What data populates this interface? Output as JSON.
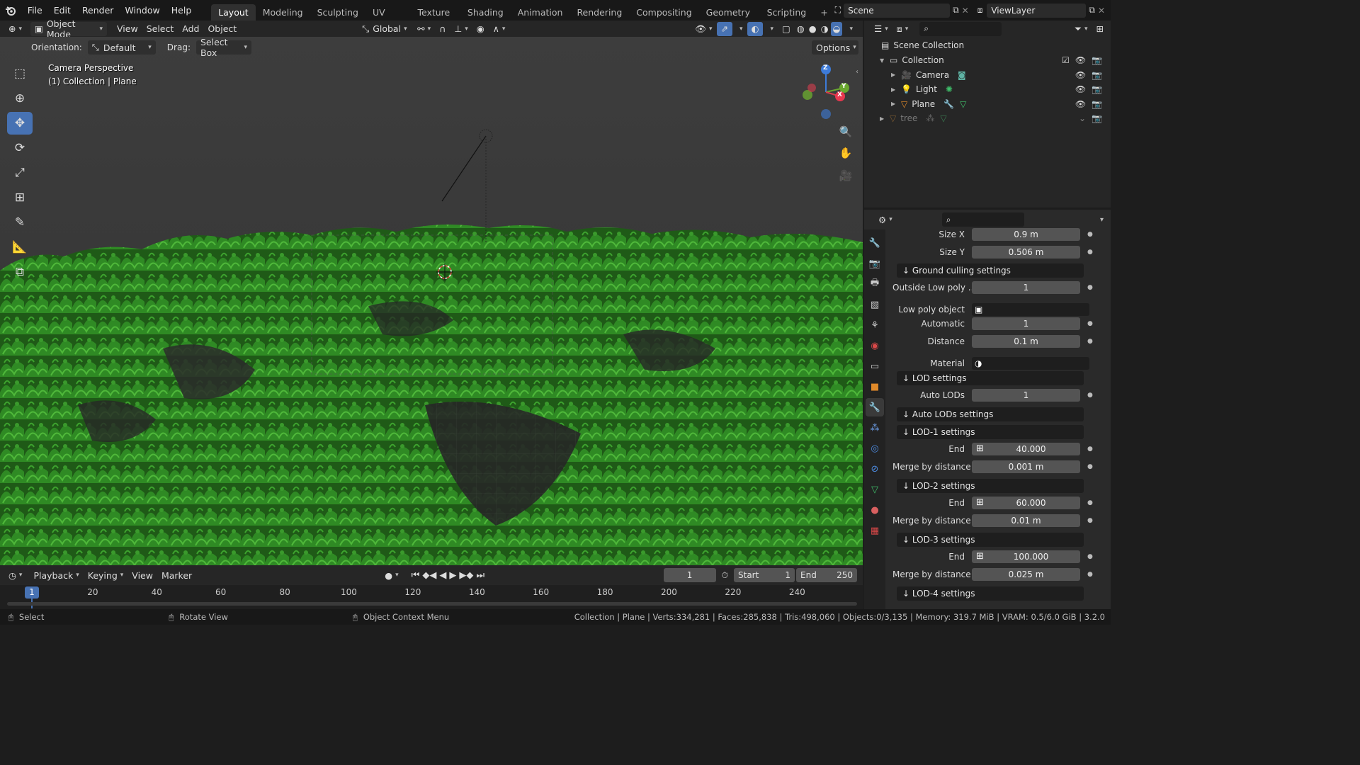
{
  "topbar": {
    "menus": [
      "File",
      "Edit",
      "Render",
      "Window",
      "Help"
    ],
    "workspaces": [
      "Layout",
      "Modeling",
      "Sculpting",
      "UV Editing",
      "Texture Paint",
      "Shading",
      "Animation",
      "Rendering",
      "Compositing",
      "Geometry Nodes",
      "Scripting"
    ],
    "active_workspace": "Layout",
    "add_workspace": "+",
    "scene_name": "Scene",
    "view_layer": "ViewLayer"
  },
  "viewport_header": {
    "mode": "Object Mode",
    "menus": [
      "View",
      "Select",
      "Add",
      "Object"
    ],
    "transform_orientation": "Global"
  },
  "tool_settings": {
    "orientation_label": "Orientation:",
    "orientation_value": "Default",
    "drag_label": "Drag:",
    "drag_value": "Select Box",
    "options": "Options"
  },
  "viewport": {
    "camera_label": "Camera Perspective",
    "collection_label": "(1) Collection | Plane",
    "gizmo": {
      "z": "Z",
      "y": "Y",
      "x": "X"
    }
  },
  "timeline": {
    "menus": [
      "Playback",
      "Keying",
      "View",
      "Marker"
    ],
    "current_frame": "1",
    "start_label": "Start",
    "start_value": "1",
    "end_label": "End",
    "end_value": "250",
    "ticks": [
      "1",
      "20",
      "40",
      "60",
      "80",
      "100",
      "120",
      "140",
      "160",
      "180",
      "200",
      "220",
      "240"
    ]
  },
  "status_bar": {
    "select": "Select",
    "rotate": "Rotate View",
    "context": "Object Context Menu",
    "info": "Collection | Plane | Verts:334,281 | Faces:285,838 | Tris:498,060 | Objects:0/3,135 | Memory: 319.7 MiB | VRAM: 0.5/6.0 GiB | 3.2.0"
  },
  "outliner": {
    "scene_collection": "Scene Collection",
    "items": [
      {
        "label": "Collection",
        "icon": "collection-icon"
      },
      {
        "label": "Camera",
        "icon": "camera-icon"
      },
      {
        "label": "Light",
        "icon": "light-icon"
      },
      {
        "label": "Plane",
        "icon": "mesh-icon"
      },
      {
        "label": "tree",
        "icon": "mesh-icon"
      }
    ]
  },
  "properties": {
    "rows": [
      {
        "type": "field",
        "label": "Size X",
        "value": "0.9 m"
      },
      {
        "type": "field",
        "label": "Size Y",
        "value": "0.506 m"
      },
      {
        "type": "section",
        "label": "↓ Ground culling settings"
      },
      {
        "type": "field",
        "label": "Outside Low poly ...",
        "value": "1"
      },
      {
        "type": "object",
        "label": "Low poly object",
        "value": ""
      },
      {
        "type": "field",
        "label": "Automatic",
        "value": "1"
      },
      {
        "type": "field",
        "label": "Distance",
        "value": "0.1 m"
      },
      {
        "type": "material",
        "label": "Material",
        "value": ""
      },
      {
        "type": "section",
        "label": "↓ LOD settings"
      },
      {
        "type": "field",
        "label": "Auto LODs",
        "value": "1"
      },
      {
        "type": "section",
        "label": "↓ Auto LODs settings"
      },
      {
        "type": "section",
        "label": "↓ LOD-1 settings"
      },
      {
        "type": "slider",
        "label": "End",
        "value": "40.000"
      },
      {
        "type": "field",
        "label": "Merge by distance",
        "value": "0.001 m"
      },
      {
        "type": "section",
        "label": "↓ LOD-2 settings"
      },
      {
        "type": "slider",
        "label": "End",
        "value": "60.000"
      },
      {
        "type": "field",
        "label": "Merge by distance",
        "value": "0.01 m"
      },
      {
        "type": "section",
        "label": "↓ LOD-3 settings"
      },
      {
        "type": "slider",
        "label": "End",
        "value": "100.000"
      },
      {
        "type": "field",
        "label": "Merge by distance",
        "value": "0.025 m"
      },
      {
        "type": "section",
        "label": "↓ LOD-4 settings"
      }
    ]
  },
  "colors": {
    "accent": "#4772b3",
    "foliage": "#2e7a22",
    "background": "#1d1d1d"
  }
}
